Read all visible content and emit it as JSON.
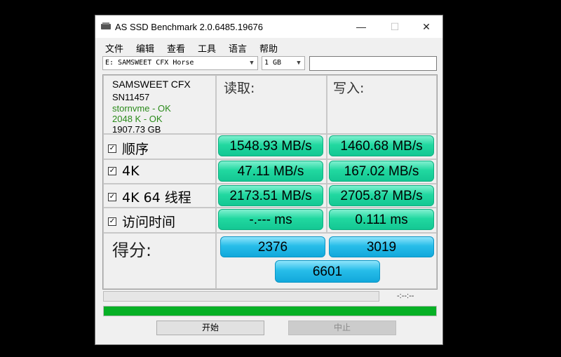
{
  "window": {
    "title": "AS SSD Benchmark 2.0.6485.19676",
    "controls": {
      "minimize": "—",
      "maximize": "☐",
      "close": "✕"
    }
  },
  "menu": [
    "文件",
    "编辑",
    "查看",
    "工具",
    "语言",
    "帮助"
  ],
  "drive_select": {
    "value": "E: SAMSWEET CFX Horse"
  },
  "size_select": {
    "value": "1 GB"
  },
  "drive_info": {
    "name": "SAMSWEET CFX",
    "serial": "SN11457",
    "driver": "stornvme - OK",
    "alignment": "2048 K - OK",
    "capacity": "1907.73 GB"
  },
  "headers": {
    "read": "读取:",
    "write": "写入:"
  },
  "rows": [
    {
      "label": "顺序",
      "read": "1548.93 MB/s",
      "write": "1460.68 MB/s"
    },
    {
      "label": "4K",
      "read": "47.11 MB/s",
      "write": "167.02 MB/s"
    },
    {
      "label": "4K 64 线程",
      "read": "2173.51 MB/s",
      "write": "2705.87 MB/s"
    },
    {
      "label": "访问时间",
      "read": "-.--- ms",
      "write": "0.111 ms"
    }
  ],
  "score": {
    "label": "得分:",
    "read": "2376",
    "write": "3019",
    "total": "6601"
  },
  "elapsed_time": "-:--:--",
  "progress_fraction": 1.0,
  "buttons": {
    "start": "开始",
    "stop": "中止"
  },
  "colors": {
    "result_green": "#21d8a0",
    "score_blue": "#27bde9",
    "progress_green": "#06b025",
    "info_ok_green": "#2a8a1a"
  },
  "icons": [
    "drive-icon",
    "chevron-down-icon",
    "checkbox-icon"
  ]
}
